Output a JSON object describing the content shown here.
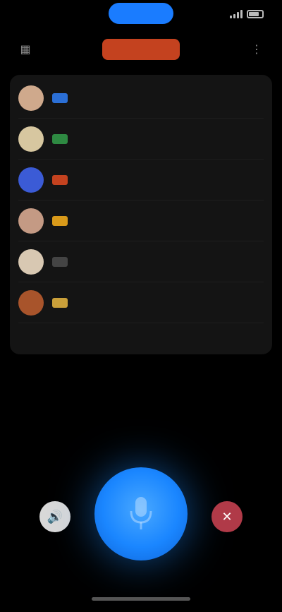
{
  "status": {
    "time": "",
    "pill_label": "",
    "battery_icon": "battery-icon",
    "signal_icon": "signal-icon"
  },
  "topbar": {
    "left_icon": "grid-icon",
    "right_icon": "settings-icon",
    "badge_label": "",
    "badge_color": "#c4421f"
  },
  "list": {
    "rows": [
      {
        "name": "",
        "sub": "",
        "right": "",
        "avatar_color": "#cfa98c",
        "tag_color": "#2b6fd6"
      },
      {
        "name": "",
        "sub": "",
        "right": "",
        "avatar_color": "#d7c7a0",
        "tag_color": "#2e8a42"
      },
      {
        "name": "",
        "sub": "",
        "right": "",
        "avatar_color": "#3b5bd6",
        "tag_color": "#c4421f"
      },
      {
        "name": "",
        "sub": "",
        "right": "",
        "avatar_color": "#c49a84",
        "tag_color": "#d99a1a"
      },
      {
        "name": "",
        "sub": "",
        "right": "",
        "avatar_color": "#d8c8b2",
        "tag_color": "#444444"
      },
      {
        "name": "",
        "sub": "",
        "right": "",
        "avatar_color": "#a8542b",
        "tag_color": "#caa03a"
      }
    ],
    "more_link": ""
  },
  "controls": {
    "mic_color": "#1a86ff",
    "left_label": "",
    "right_label": "",
    "left_icon": "speaker-icon",
    "right_icon": "end-call-icon"
  }
}
